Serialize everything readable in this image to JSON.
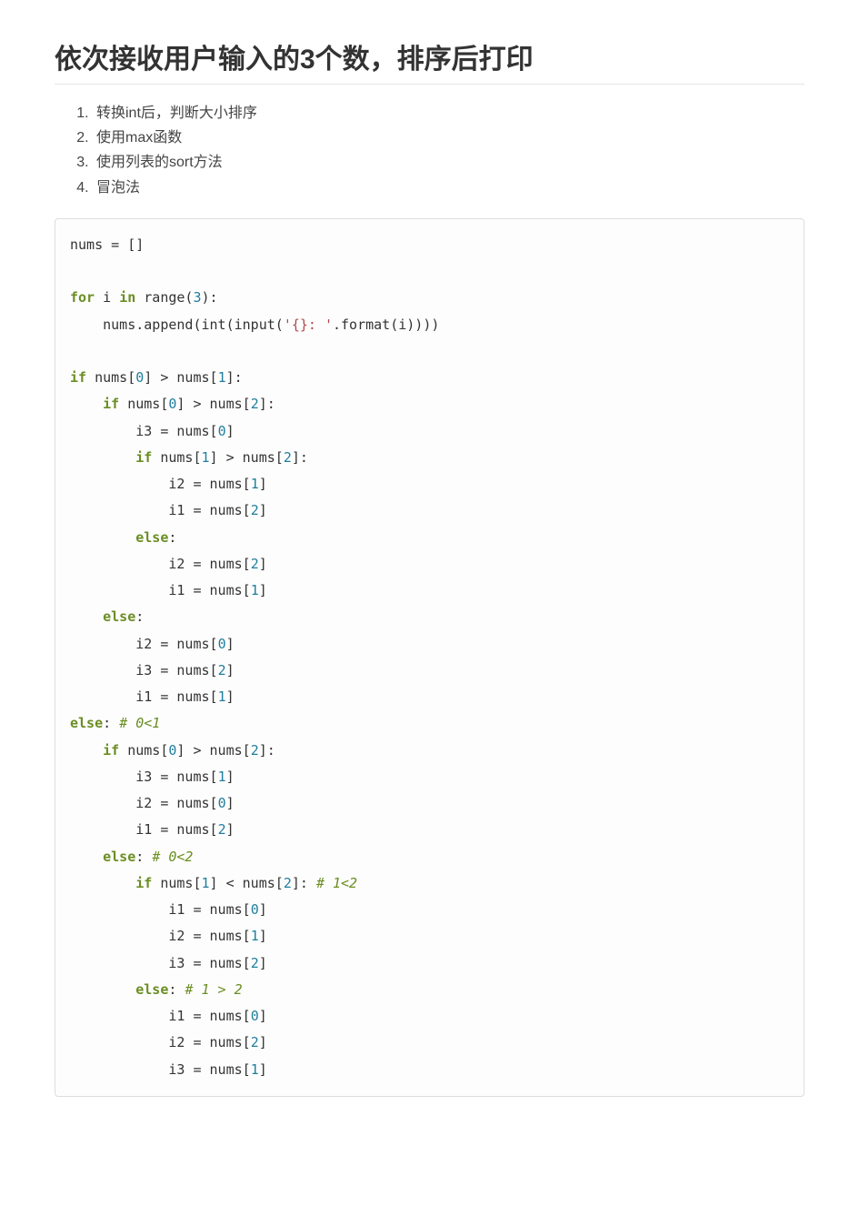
{
  "heading": "依次接收用户输入的3个数，排序后打印",
  "methods": [
    "转换int后，判断大小排序",
    "使用max函数",
    "使用列表的sort方法",
    "冒泡法"
  ],
  "code": {
    "lines": [
      [
        {
          "t": "nums = []",
          "c": "pl"
        }
      ],
      [],
      [
        {
          "t": "for",
          "c": "kw"
        },
        {
          "t": " i ",
          "c": "pl"
        },
        {
          "t": "in",
          "c": "kw"
        },
        {
          "t": " range(",
          "c": "pl"
        },
        {
          "t": "3",
          "c": "num"
        },
        {
          "t": "):",
          "c": "pl"
        }
      ],
      [
        {
          "t": "    nums.append(int(input(",
          "c": "pl"
        },
        {
          "t": "'{}: '",
          "c": "str"
        },
        {
          "t": ".format(i))))",
          "c": "pl"
        }
      ],
      [],
      [
        {
          "t": "if",
          "c": "kw"
        },
        {
          "t": " nums[",
          "c": "pl"
        },
        {
          "t": "0",
          "c": "num"
        },
        {
          "t": "] > nums[",
          "c": "pl"
        },
        {
          "t": "1",
          "c": "num"
        },
        {
          "t": "]:",
          "c": "pl"
        }
      ],
      [
        {
          "t": "    ",
          "c": "pl"
        },
        {
          "t": "if",
          "c": "kw"
        },
        {
          "t": " nums[",
          "c": "pl"
        },
        {
          "t": "0",
          "c": "num"
        },
        {
          "t": "] > nums[",
          "c": "pl"
        },
        {
          "t": "2",
          "c": "num"
        },
        {
          "t": "]:",
          "c": "pl"
        }
      ],
      [
        {
          "t": "        i3 = nums[",
          "c": "pl"
        },
        {
          "t": "0",
          "c": "num"
        },
        {
          "t": "]",
          "c": "pl"
        }
      ],
      [
        {
          "t": "        ",
          "c": "pl"
        },
        {
          "t": "if",
          "c": "kw"
        },
        {
          "t": " nums[",
          "c": "pl"
        },
        {
          "t": "1",
          "c": "num"
        },
        {
          "t": "] > nums[",
          "c": "pl"
        },
        {
          "t": "2",
          "c": "num"
        },
        {
          "t": "]:",
          "c": "pl"
        }
      ],
      [
        {
          "t": "            i2 = nums[",
          "c": "pl"
        },
        {
          "t": "1",
          "c": "num"
        },
        {
          "t": "]",
          "c": "pl"
        }
      ],
      [
        {
          "t": "            i1 = nums[",
          "c": "pl"
        },
        {
          "t": "2",
          "c": "num"
        },
        {
          "t": "]",
          "c": "pl"
        }
      ],
      [
        {
          "t": "        ",
          "c": "pl"
        },
        {
          "t": "else",
          "c": "kw"
        },
        {
          "t": ":",
          "c": "pl"
        }
      ],
      [
        {
          "t": "            i2 = nums[",
          "c": "pl"
        },
        {
          "t": "2",
          "c": "num"
        },
        {
          "t": "]",
          "c": "pl"
        }
      ],
      [
        {
          "t": "            i1 = nums[",
          "c": "pl"
        },
        {
          "t": "1",
          "c": "num"
        },
        {
          "t": "]",
          "c": "pl"
        }
      ],
      [
        {
          "t": "    ",
          "c": "pl"
        },
        {
          "t": "else",
          "c": "kw"
        },
        {
          "t": ":",
          "c": "pl"
        }
      ],
      [
        {
          "t": "        i2 = nums[",
          "c": "pl"
        },
        {
          "t": "0",
          "c": "num"
        },
        {
          "t": "]",
          "c": "pl"
        }
      ],
      [
        {
          "t": "        i3 = nums[",
          "c": "pl"
        },
        {
          "t": "2",
          "c": "num"
        },
        {
          "t": "]",
          "c": "pl"
        }
      ],
      [
        {
          "t": "        i1 = nums[",
          "c": "pl"
        },
        {
          "t": "1",
          "c": "num"
        },
        {
          "t": "]",
          "c": "pl"
        }
      ],
      [
        {
          "t": "else",
          "c": "kw"
        },
        {
          "t": ": ",
          "c": "pl"
        },
        {
          "t": "# 0<1",
          "c": "cm"
        }
      ],
      [
        {
          "t": "    ",
          "c": "pl"
        },
        {
          "t": "if",
          "c": "kw"
        },
        {
          "t": " nums[",
          "c": "pl"
        },
        {
          "t": "0",
          "c": "num"
        },
        {
          "t": "] > nums[",
          "c": "pl"
        },
        {
          "t": "2",
          "c": "num"
        },
        {
          "t": "]:",
          "c": "pl"
        }
      ],
      [
        {
          "t": "        i3 = nums[",
          "c": "pl"
        },
        {
          "t": "1",
          "c": "num"
        },
        {
          "t": "]",
          "c": "pl"
        }
      ],
      [
        {
          "t": "        i2 = nums[",
          "c": "pl"
        },
        {
          "t": "0",
          "c": "num"
        },
        {
          "t": "]",
          "c": "pl"
        }
      ],
      [
        {
          "t": "        i1 = nums[",
          "c": "pl"
        },
        {
          "t": "2",
          "c": "num"
        },
        {
          "t": "]",
          "c": "pl"
        }
      ],
      [
        {
          "t": "    ",
          "c": "pl"
        },
        {
          "t": "else",
          "c": "kw"
        },
        {
          "t": ": ",
          "c": "pl"
        },
        {
          "t": "# 0<2",
          "c": "cm"
        }
      ],
      [
        {
          "t": "        ",
          "c": "pl"
        },
        {
          "t": "if",
          "c": "kw"
        },
        {
          "t": " nums[",
          "c": "pl"
        },
        {
          "t": "1",
          "c": "num"
        },
        {
          "t": "] < nums[",
          "c": "pl"
        },
        {
          "t": "2",
          "c": "num"
        },
        {
          "t": "]: ",
          "c": "pl"
        },
        {
          "t": "# 1<2",
          "c": "cm"
        }
      ],
      [
        {
          "t": "            i1 = nums[",
          "c": "pl"
        },
        {
          "t": "0",
          "c": "num"
        },
        {
          "t": "]",
          "c": "pl"
        }
      ],
      [
        {
          "t": "            i2 = nums[",
          "c": "pl"
        },
        {
          "t": "1",
          "c": "num"
        },
        {
          "t": "]",
          "c": "pl"
        }
      ],
      [
        {
          "t": "            i3 = nums[",
          "c": "pl"
        },
        {
          "t": "2",
          "c": "num"
        },
        {
          "t": "]",
          "c": "pl"
        }
      ],
      [
        {
          "t": "        ",
          "c": "pl"
        },
        {
          "t": "else",
          "c": "kw"
        },
        {
          "t": ": ",
          "c": "pl"
        },
        {
          "t": "# 1 > 2",
          "c": "cm"
        }
      ],
      [
        {
          "t": "            i1 = nums[",
          "c": "pl"
        },
        {
          "t": "0",
          "c": "num"
        },
        {
          "t": "]",
          "c": "pl"
        }
      ],
      [
        {
          "t": "            i2 = nums[",
          "c": "pl"
        },
        {
          "t": "2",
          "c": "num"
        },
        {
          "t": "]",
          "c": "pl"
        }
      ],
      [
        {
          "t": "            i3 = nums[",
          "c": "pl"
        },
        {
          "t": "1",
          "c": "num"
        },
        {
          "t": "]",
          "c": "pl"
        }
      ]
    ]
  }
}
